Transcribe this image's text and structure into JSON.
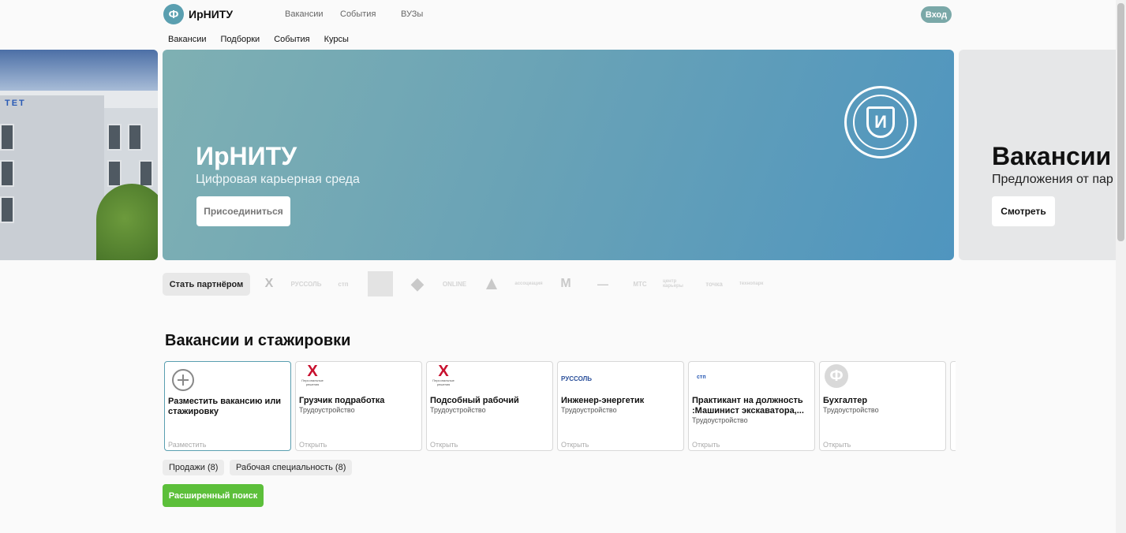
{
  "header": {
    "logo_letter": "Ф",
    "logo_text": "ИрНИТУ",
    "nav": [
      "Вакансии",
      "События",
      "ВУЗы"
    ],
    "login_label": "Вход"
  },
  "subnav": [
    "Вакансии",
    "Подборки",
    "События",
    "Курсы"
  ],
  "carousel": {
    "left_sign": "ТЕТ",
    "main": {
      "title": "ИрНИТУ",
      "subtitle": "Цифровая карьерная среда",
      "button": "Присоединиться",
      "emblem_letter": "И"
    },
    "right": {
      "title": "Вакансии",
      "subtitle": "Предложения от пар",
      "button": "Смотреть"
    }
  },
  "partners": {
    "button": "Стать партнёром",
    "logos": [
      "Х",
      "РУССОЛЬ",
      "стп",
      "",
      "◆",
      "ONLINE",
      "▲",
      "ассоциация",
      "М",
      "—",
      "МТС",
      "центр карьеры",
      "точка",
      "Технопарк"
    ]
  },
  "vacancies": {
    "title": "Вакансии и стажировки",
    "cards": [
      {
        "title": "Разместить вакансию или стажировку",
        "category": "",
        "action": "Разместить",
        "logo": "plus-icon"
      },
      {
        "title": "Грузчик подработка",
        "category": "Трудоустройство",
        "action": "Открыть",
        "logo": "Х"
      },
      {
        "title": "Подсобный рабочий",
        "category": "Трудоустройство",
        "action": "Открыть",
        "logo": "Х"
      },
      {
        "title": "Инженер-энергетик",
        "category": "Трудоустройство",
        "action": "Открыть",
        "logo": "РУССОЛЬ"
      },
      {
        "title": "Практикант на должность :Машинист экскаватора,...",
        "category": "Трудоустройство",
        "action": "Открыть",
        "logo": "стп"
      },
      {
        "title": "Бухгалтер",
        "category": "Трудоустройство",
        "action": "Открыть",
        "logo": "Ф"
      }
    ],
    "tags": [
      "Продажи (8)",
      "Рабочая специальность (8)"
    ],
    "search_button": "Расширенный поиск"
  },
  "colors": {
    "brand": "#5a9fb0",
    "accent_green": "#5cbf3a",
    "login": "#7aa8a8"
  }
}
